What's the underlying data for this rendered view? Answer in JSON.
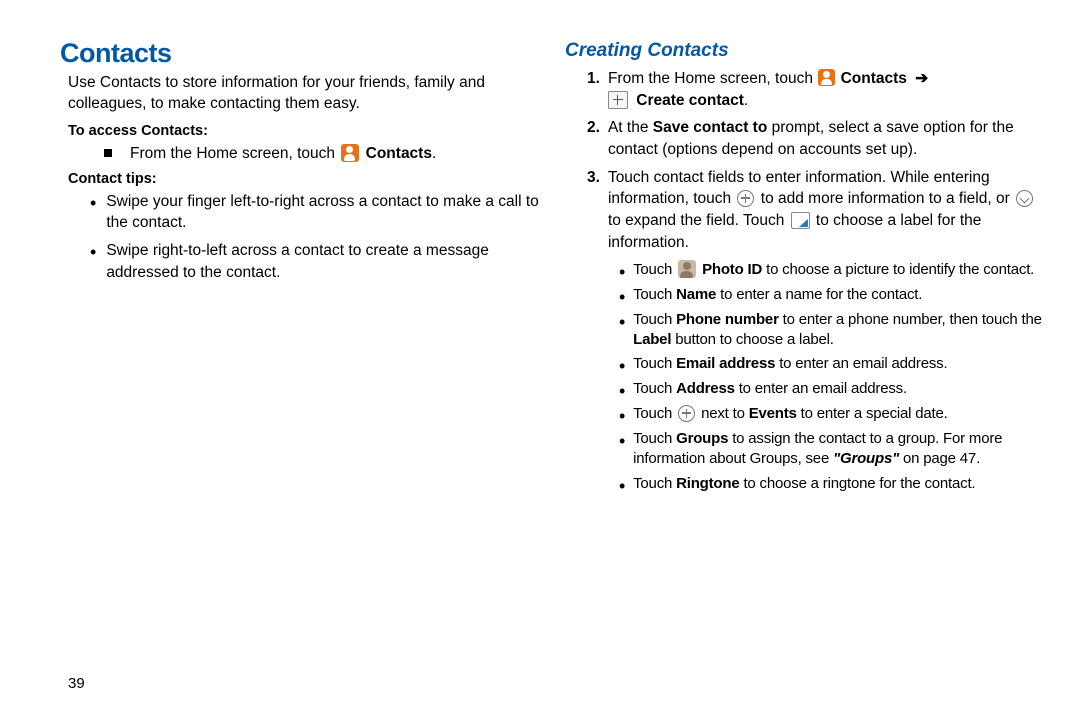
{
  "left": {
    "title": "Contacts",
    "intro": "Use Contacts to store information for your friends, family and colleagues, to make contacting them easy.",
    "access_heading": "To access Contacts:",
    "access_pre": "From the Home screen, touch ",
    "access_label": " Contacts",
    "access_post": ".",
    "tips_heading": "Contact tips:",
    "tip1": "Swipe your finger left-to-right across a contact to make a call to the contact.",
    "tip2": "Swipe right-to-left across a contact to create a message addressed to the contact."
  },
  "right": {
    "title": "Creating Contacts",
    "s1_pre": "From the Home screen, touch ",
    "s1_contacts": " Contacts ",
    "s1_arrow": "➔",
    "s1_create": " Create contact",
    "s1_post": ".",
    "s2a": "At the ",
    "s2b": "Save contact to",
    "s2c": " prompt, select a save option for the contact (options depend on accounts set up).",
    "s3a": "Touch contact fields to enter information. While entering information, touch ",
    "s3b": " to add more information to a field, or ",
    "s3c": " to expand the field. Touch ",
    "s3d": " to choose a label for the information.",
    "b_photo_a": "Touch ",
    "b_photo_b": " Photo ID",
    "b_photo_c": " to choose a picture to identify the contact.",
    "b_name_a": "Touch ",
    "b_name_b": "Name",
    "b_name_c": " to enter a name for the contact.",
    "b_phone_a": "Touch ",
    "b_phone_b": "Phone number",
    "b_phone_c": " to enter a phone number, then touch the ",
    "b_phone_d": "Label",
    "b_phone_e": " button to choose a label.",
    "b_email_a": "Touch ",
    "b_email_b": "Email address",
    "b_email_c": " to enter an email address.",
    "b_addr_a": "Touch ",
    "b_addr_b": "Address",
    "b_addr_c": " to enter an email address.",
    "b_events_a": "Touch ",
    "b_events_b": " next to ",
    "b_events_c": "Events",
    "b_events_d": " to enter a special date.",
    "b_groups_a": "Touch ",
    "b_groups_b": "Groups",
    "b_groups_c": " to assign the contact to a group. For more information about Groups, see ",
    "b_groups_d": "\"Groups\"",
    "b_groups_e": " on page 47.",
    "b_ring_a": "Touch ",
    "b_ring_b": "Ringtone",
    "b_ring_c": " to choose a ringtone for the contact."
  },
  "page": "39"
}
